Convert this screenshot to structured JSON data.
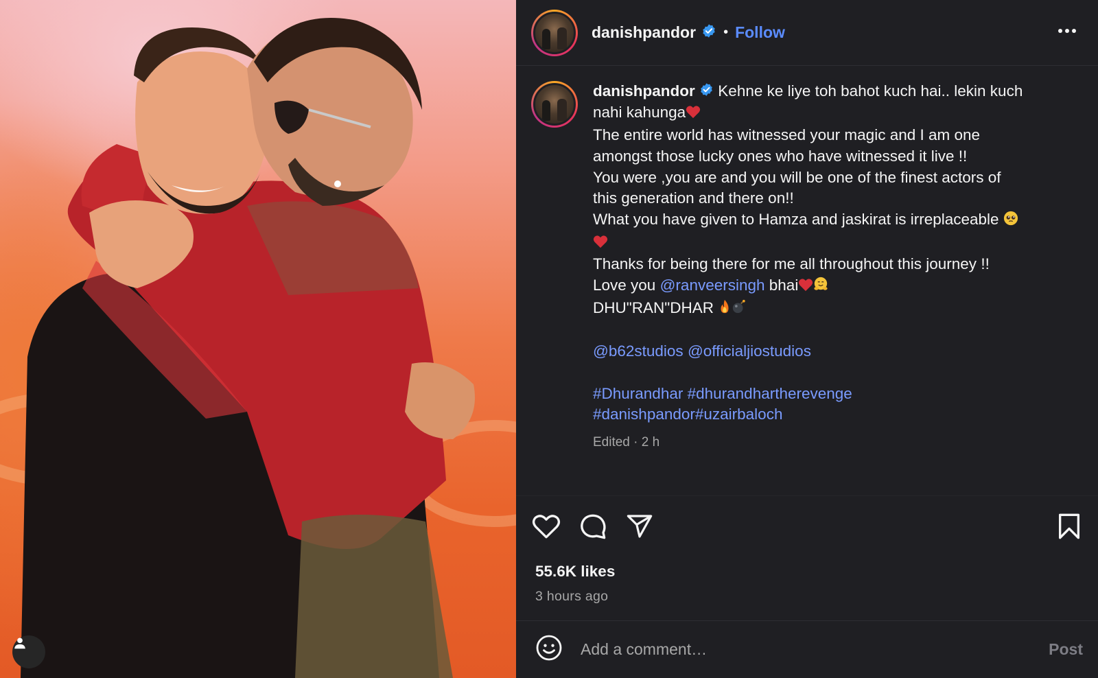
{
  "post": {
    "photo_alt": "Two men hugging on an orange background",
    "photo_icon": "user-tag-icon"
  },
  "header": {
    "username": "danishpandor",
    "verified_icon": "verified-badge-icon",
    "separator": "•",
    "follow_label": "Follow",
    "more_icon": "more-options-icon"
  },
  "caption": {
    "username": "danishpandor",
    "lines": [
      "Kehne ke liye toh bahot kuch hai.. lekin kuch",
      "nahi kahunga",
      "The entire world has witnessed your magic and I am one",
      "amongst those lucky ones who have witnessed it live !!",
      "You were ,you are and you will be one of the finest actors of",
      "this generation and there on!!",
      "What you have given to Hamza and jaskirat is irreplaceable",
      "Thanks for being there for me all throughout this journey !!",
      "Love you",
      "bhai",
      "DHU\"RAN\"DHAR"
    ],
    "mention_ranveer": "@ranveersingh",
    "mention_b62": "@b62studios",
    "mention_jio": "@officialjiostudios",
    "hashtag_line1a": "#Dhurandhar",
    "hashtag_line1b": "#dhurandhartherevenge",
    "hashtag_line2": "#danishpandor#uzairbaloch",
    "meta": "Edited · 2 h"
  },
  "actions": {
    "like_icon": "heart-icon",
    "comment_icon": "comment-icon",
    "share_icon": "share-icon",
    "save_icon": "bookmark-icon"
  },
  "stats": {
    "likes": "55.6K likes",
    "time_ago": "3 hours ago"
  },
  "comment": {
    "emoji_icon": "emoji-icon",
    "placeholder": "Add a comment…",
    "post_label": "Post"
  },
  "colors": {
    "panel_bg": "#1f1f23",
    "link": "#7a9bff",
    "follow": "#5b8cff",
    "muted": "#a8a8a8",
    "verified": "#3897f0"
  }
}
